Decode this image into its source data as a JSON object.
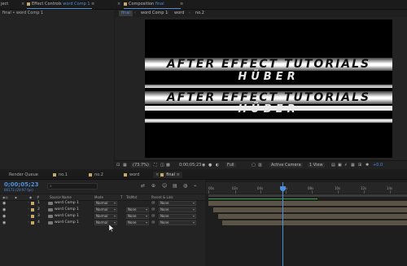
{
  "left_panel": {
    "project_tab_fragment": "ject",
    "effect_controls_label": "Effect Controls",
    "effect_controls_target": "word Comp 1",
    "breadcrumb": "final • word Comp 1"
  },
  "comp_panel": {
    "title_label": "Composition",
    "title_target": "final",
    "nav": [
      "final",
      "word Comp 1",
      "word",
      "no.2"
    ],
    "nav_separator": "‹"
  },
  "viewer_text": {
    "line1": "AFTER EFFECT TUTORIALS",
    "line2": "HÜBER",
    "line3": "AFTER EFFECT TUTORIALS",
    "line4": "HÜBER"
  },
  "viewer_bar": {
    "zoom": "(73.7%)",
    "timecode": "0;00;05;23",
    "resolution": "Full",
    "camera": "Active Camera",
    "views": "1 View",
    "exposure": "+0.0"
  },
  "timeline": {
    "tabs": [
      {
        "label": "Render Queue",
        "color": ""
      },
      {
        "label": "no.1",
        "color": "#c8a869"
      },
      {
        "label": "no.2",
        "color": "#c8a869"
      },
      {
        "label": "word",
        "color": "#c8a869"
      },
      {
        "label": "final",
        "color": "#c8a869"
      }
    ],
    "timecode": "0;00;05;23",
    "fps": "00173 (29.97 fps)",
    "search_placeholder": "",
    "columns": {
      "num": "#",
      "source": "Source Name",
      "mode": "Mode",
      "t": "T",
      "trkmat": "TrkMat",
      "parent": "Parent & Link"
    },
    "layers": [
      {
        "num": "1",
        "name": "word Comp 1",
        "mode": "Normal",
        "trkmat": "",
        "parent": "None"
      },
      {
        "num": "2",
        "name": "word Comp 1",
        "mode": "Normal",
        "trkmat": "None",
        "parent": "None"
      },
      {
        "num": "3",
        "name": "word Comp 1",
        "mode": "Normal",
        "trkmat": "None",
        "parent": "None"
      },
      {
        "num": "4",
        "name": "word Comp 1",
        "mode": "Normal",
        "trkmat": "None",
        "parent": "None"
      }
    ],
    "ruler": [
      "00s",
      "02s",
      "04s",
      "06s",
      "08s",
      "10s",
      "12s",
      "14s"
    ]
  },
  "colors": {
    "accent": "#4d8fdb",
    "label_swatch": "#c8a869",
    "layer_bar": "#5b5346",
    "work_area_green": "#3aa44a"
  }
}
